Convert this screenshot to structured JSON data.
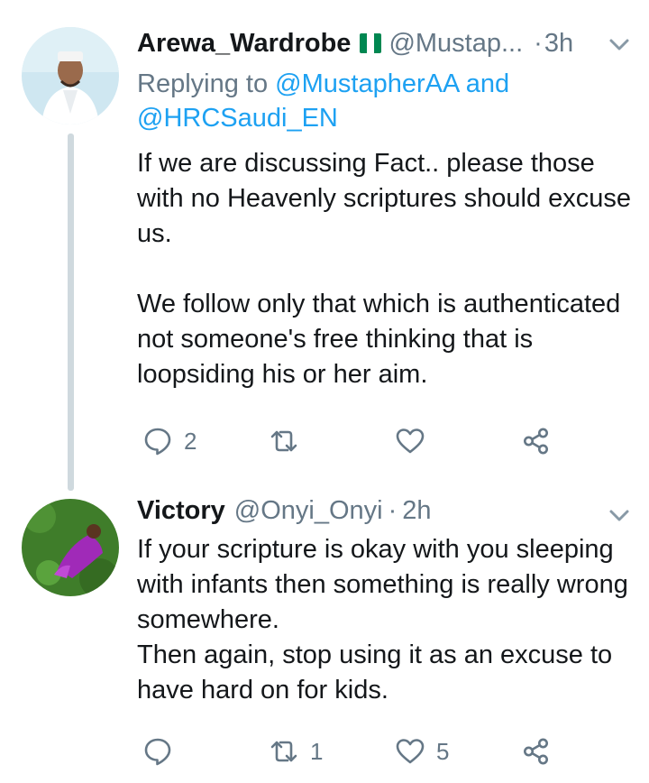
{
  "tweet1": {
    "display_name": "Arewa_Wardrobe",
    "handle": "@Mustap...",
    "separator": "·",
    "time": "3h",
    "reply_prefix": "Replying to",
    "reply_user1": "@MustapherAA",
    "reply_and": "and",
    "reply_user2": "@HRCSaudi_EN",
    "paragraph1": "If we are discussing Fact.. please those with no Heavenly scriptures should excuse us.",
    "paragraph2": "We follow only that which is authenticated not someone's free thinking that is loopsiding his or her aim.",
    "reply_count": "2",
    "retweet_count": "",
    "like_count": ""
  },
  "tweet2": {
    "display_name": "Victory",
    "handle": "@Onyi_Onyi",
    "separator": "·",
    "time": "2h",
    "paragraph1": "If your scripture is okay with you sleeping with infants then something is really wrong somewhere.",
    "paragraph2": "Then again, stop using it as an excuse to have hard on for kids.",
    "reply_count": "",
    "retweet_count": "1",
    "like_count": "5"
  },
  "icons": [
    "reply-icon",
    "retweet-icon",
    "like-icon",
    "share-icon",
    "chevron-down-icon",
    "nigeria-flag-icon"
  ],
  "colors": {
    "text": "#14171a",
    "secondary": "#657786",
    "link": "#1da1f2",
    "thread_line": "#cfd9de",
    "flag_green": "#008751"
  }
}
